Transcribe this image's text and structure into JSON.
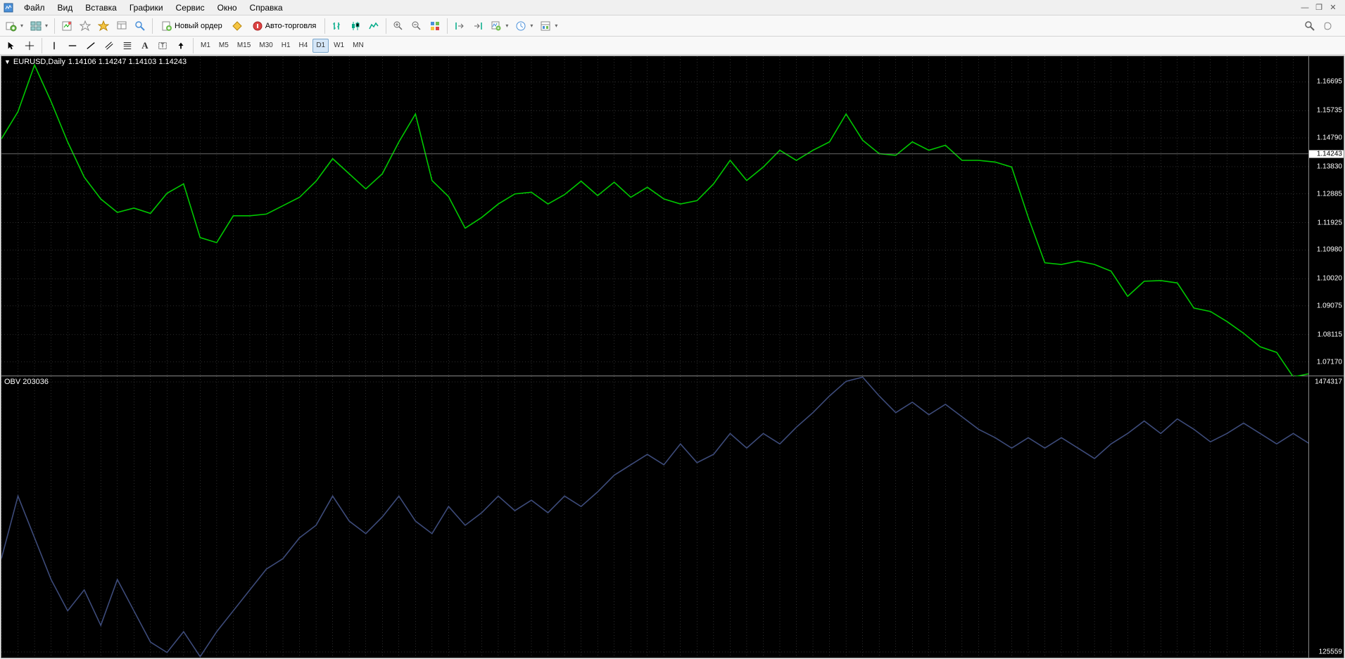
{
  "menu": {
    "items": [
      "Файл",
      "Вид",
      "Вставка",
      "Графики",
      "Сервис",
      "Окно",
      "Справка"
    ]
  },
  "toolbar1": {
    "new_order": "Новый ордер",
    "auto_trading": "Авто-торговля"
  },
  "timeframes": [
    "M1",
    "M5",
    "M15",
    "M30",
    "H1",
    "H4",
    "D1",
    "W1",
    "MN"
  ],
  "active_timeframe": "D1",
  "chart": {
    "symbol": "EURUSD,Daily",
    "ohlc": "1.14106 1.14247 1.14103 1.14243",
    "indicator_label": "OBV 203036",
    "price_ticks": [
      {
        "v": "1.16695",
        "p": 0.08
      },
      {
        "v": "1.15735",
        "p": 0.17
      },
      {
        "v": "1.14790",
        "p": 0.255
      },
      {
        "v": "1.14243",
        "p": 0.305,
        "current": true
      },
      {
        "v": "1.13830",
        "p": 0.345
      },
      {
        "v": "1.12885",
        "p": 0.43
      },
      {
        "v": "1.11925",
        "p": 0.52
      },
      {
        "v": "1.10980",
        "p": 0.605
      },
      {
        "v": "1.10020",
        "p": 0.695
      },
      {
        "v": "1.09075",
        "p": 0.78
      },
      {
        "v": "1.08115",
        "p": 0.87
      },
      {
        "v": "1.07170",
        "p": 0.955
      }
    ],
    "obv_ticks": [
      {
        "v": "1474317",
        "p": 0.02
      },
      {
        "v": "125559",
        "p": 0.98
      }
    ]
  },
  "colors": {
    "price_line": "#00c800",
    "obv_line": "#3d4b7a",
    "grid": "#5a5a5a"
  },
  "chart_data": {
    "type": "line",
    "symbol": "EURUSD",
    "timeframe": "Daily",
    "price_series": {
      "name": "Close",
      "ylim": [
        1.0717,
        1.167
      ],
      "values": [
        1.1424,
        1.1505,
        1.1644,
        1.1535,
        1.1415,
        1.131,
        1.1245,
        1.1205,
        1.1218,
        1.1202,
        1.1262,
        1.129,
        1.113,
        1.1115,
        1.1195,
        1.1195,
        1.12,
        1.1225,
        1.125,
        1.1298,
        1.1365,
        1.132,
        1.1275,
        1.132,
        1.1415,
        1.1498,
        1.13,
        1.1252,
        1.1158,
        1.119,
        1.123,
        1.126,
        1.1265,
        1.123,
        1.1258,
        1.1298,
        1.1255,
        1.1295,
        1.125,
        1.128,
        1.1245,
        1.123,
        1.124,
        1.129,
        1.136,
        1.13,
        1.134,
        1.139,
        1.136,
        1.139,
        1.1415,
        1.1498,
        1.142,
        1.138,
        1.1375,
        1.1415,
        1.139,
        1.1405,
        1.136,
        1.136,
        1.1355,
        1.134,
        1.119,
        1.1055,
        1.105,
        1.106,
        1.105,
        1.103,
        1.0955,
        1.1,
        1.1002,
        1.0995,
        1.092,
        1.091,
        1.088,
        1.0845,
        1.0805,
        1.0788,
        1.0715,
        1.0725
      ]
    },
    "obv_series": {
      "name": "OBV",
      "ylim": [
        125559,
        1474317
      ],
      "values": [
        600000,
        900000,
        700000,
        500000,
        350000,
        450000,
        280000,
        500000,
        350000,
        200000,
        150000,
        250000,
        130000,
        250000,
        350000,
        450000,
        550000,
        600000,
        700000,
        760000,
        900000,
        780000,
        720000,
        800000,
        900000,
        780000,
        720000,
        850000,
        760000,
        820000,
        900000,
        830000,
        880000,
        820000,
        900000,
        850000,
        920000,
        1000000,
        1050000,
        1100000,
        1050000,
        1150000,
        1060000,
        1100000,
        1200000,
        1130000,
        1200000,
        1150000,
        1230000,
        1300000,
        1380000,
        1450000,
        1470000,
        1380000,
        1300000,
        1350000,
        1290000,
        1340000,
        1280000,
        1220000,
        1180000,
        1130000,
        1180000,
        1130000,
        1180000,
        1130000,
        1080000,
        1150000,
        1200000,
        1260000,
        1200000,
        1270000,
        1220000,
        1160000,
        1200000,
        1250000,
        1200000,
        1150000,
        1200000,
        1150000
      ]
    }
  }
}
